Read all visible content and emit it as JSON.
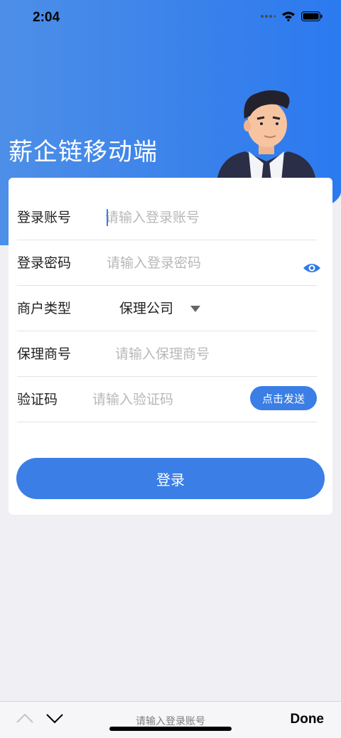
{
  "status_bar": {
    "time": "2:04",
    "icons": [
      "signal-dots-icon",
      "wifi-icon",
      "battery-icon"
    ]
  },
  "header": {
    "title": "薪企链移动端"
  },
  "form": {
    "account": {
      "label": "登录账号",
      "placeholder": "请输入登录账号",
      "value": ""
    },
    "password": {
      "label": "登录密码",
      "placeholder": "请输入登录密码",
      "value": ""
    },
    "merchant_type": {
      "label": "商户类型",
      "selected": "保理公司"
    },
    "factoring_code": {
      "label": "保理商号",
      "placeholder": "请输入保理商号",
      "value": ""
    },
    "verification": {
      "label": "验证码",
      "placeholder": "请输入验证码",
      "value": "",
      "send_label": "点击发送"
    },
    "login_label": "登录"
  },
  "keyboard_toolbar": {
    "hint": "请输入登录账号",
    "done_label": "Done"
  },
  "colors": {
    "accent": "#3a7ee6",
    "header_gradient_start": "#4d8fe8",
    "header_gradient_end": "#2b7af0",
    "background": "#efeff4"
  }
}
